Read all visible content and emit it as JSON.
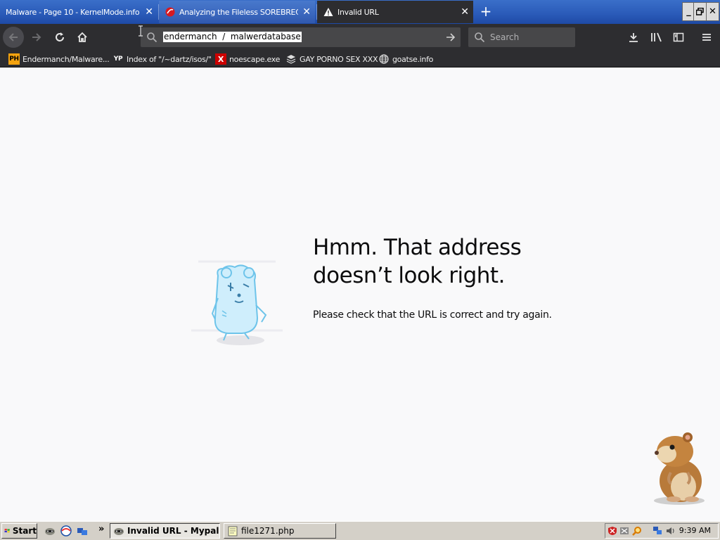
{
  "tabs": [
    {
      "title": "Malware - Page 10 - KernelMode.info",
      "icon": "none"
    },
    {
      "title": "Analyzing the Fileless SOREBRECT",
      "icon": "trend-micro-icon"
    },
    {
      "title": "Invalid URL",
      "icon": "warning-icon"
    }
  ],
  "window_controls": {
    "minimize": "_",
    "restore": "🗗",
    "close": "✕"
  },
  "urlbar": {
    "value": "endermanch  /  malwerdatabase"
  },
  "search": {
    "placeholder": "Search"
  },
  "bookmarks": [
    {
      "label": "Endermanch/Malware...",
      "icon": "PH"
    },
    {
      "label": "Index of \"/~dartz/isos/\"",
      "icon": "YP"
    },
    {
      "label": "noescape.exe",
      "icon": "X"
    },
    {
      "label": "GAY PORNO SEX XXX",
      "icon": "stack-icon"
    },
    {
      "label": "goatse.info",
      "icon": "globe-icon"
    }
  ],
  "error": {
    "title_line1": "Hmm. That address",
    "title_line2": "doesn’t look right.",
    "description": "Please check that the URL is correct and try again."
  },
  "taskbar": {
    "start": "Start",
    "tasks": [
      {
        "label": "Invalid URL - Mypal",
        "active": true
      },
      {
        "label": "file1271.php",
        "active": false
      }
    ],
    "overflow": "»",
    "clock": "9:39 AM"
  },
  "colors": {
    "tab_strip": "#2a5ab8",
    "toolbar": "#2d2d30",
    "page_bg": "#f9f9fa",
    "taskbar": "#d4d0c8"
  }
}
